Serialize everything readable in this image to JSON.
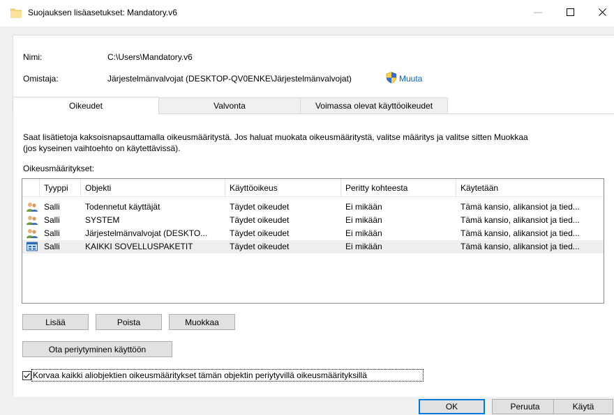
{
  "window": {
    "title": "Suojauksen lisäasetukset: Mandatory.v6",
    "minimize_glyph": "—",
    "maximize_glyph": "☐",
    "close_glyph": "✕"
  },
  "info": {
    "name_label": "Nimi:",
    "name_value": "C:\\Users\\Mandatory.v6",
    "owner_label": "Omistaja:",
    "owner_value": "Järjestelmänvalvojat (DESKTOP-QV0ENKE\\Järjestelmänvalvojat)",
    "change_link": "Muuta"
  },
  "tabs": [
    {
      "label": "Oikeudet",
      "active": true
    },
    {
      "label": "Valvonta",
      "active": false
    },
    {
      "label": "Voimassa olevat käyttöoikeudet",
      "active": false
    }
  ],
  "description_line1": "Saat lisätietoja kaksoisnapsauttamalla oikeusmääritystä. Jos haluat muokata oikeusmääritystä, valitse määritys ja valitse sitten Muokkaa",
  "description_line2": "(jos kyseinen vaihtoehto on käytettävissä).",
  "list_label": "Oikeusmääritykset:",
  "columns": [
    "Tyyppi",
    "Objekti",
    "Käyttöoikeus",
    "Peritty kohteesta",
    "Käytetään"
  ],
  "rows": [
    {
      "icon": "users-icon",
      "type": "Salli",
      "object": "Todennetut käyttäjät",
      "access": "Täydet oikeudet",
      "inherited": "Ei mikään",
      "applies": "Tämä kansio, alikansiot ja tied..."
    },
    {
      "icon": "users-icon",
      "type": "Salli",
      "object": "SYSTEM",
      "access": "Täydet oikeudet",
      "inherited": "Ei mikään",
      "applies": "Tämä kansio, alikansiot ja tied..."
    },
    {
      "icon": "users-icon",
      "type": "Salli",
      "object": "Järjestelmänvalvojat (DESKTO...",
      "access": "Täydet oikeudet",
      "inherited": "Ei mikään",
      "applies": "Tämä kansio, alikansiot ja tied..."
    },
    {
      "icon": "app-package-icon",
      "type": "Salli",
      "object": "KAIKKI SOVELLUSPAKETIT",
      "access": "Täydet oikeudet",
      "inherited": "Ei mikään",
      "applies": "Tämä kansio, alikansiot ja tied...",
      "selected": true
    }
  ],
  "buttons": {
    "add": "Lisää",
    "remove": "Poista",
    "edit": "Muokkaa",
    "enable_inheritance": "Ota periytyminen käyttöön",
    "ok": "OK",
    "cancel": "Peruuta",
    "apply": "Käytä"
  },
  "replace_checkbox": {
    "label": "Korvaa kaikki aliobjektien oikeusmääritykset tämän objektin periytyvillä oikeusmäärityksillä",
    "checked": true
  },
  "colors": {
    "link": "#0066cc",
    "accent": "#0078d7",
    "folder": "#f8d775"
  }
}
